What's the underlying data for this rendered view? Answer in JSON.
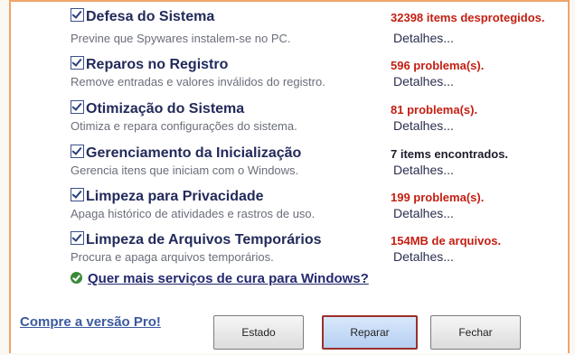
{
  "items": [
    {
      "title": "Defesa do Sistema",
      "desc": "Previne que Spywares instalem-se no PC.",
      "status": "32398 items desprotegidos.",
      "details": "Detalhes..."
    },
    {
      "title": "Reparos no Registro",
      "desc": "Remove entradas e valores inválidos do registro.",
      "status": "596 problema(s).",
      "details": "Detalhes..."
    },
    {
      "title": "Otimização do Sistema",
      "desc": "Otimiza e repara configurações do sistema.",
      "status": "81 problema(s).",
      "details": "Detalhes..."
    },
    {
      "title": "Gerenciamento da Inicialização",
      "desc": "Gerencia itens que iniciam com o Windows.",
      "status": "7 items encontrados.",
      "details": "Detalhes..."
    },
    {
      "title": "Limpeza para Privacidade",
      "desc": "Apaga histórico de atividades e rastros de uso.",
      "status": "199 problema(s).",
      "details": "Detalhes..."
    },
    {
      "title": "Limpeza de Arquivos Temporários",
      "desc": "Procura e apaga arquivos temporários.",
      "status": "154MB de arquivos.",
      "details": "Detalhes..."
    }
  ],
  "more_link": "Quer mais serviços de cura para Windows?",
  "buy_link": "Compre a versão Pro!",
  "buttons": {
    "status": "Estado",
    "repair": "Reparar",
    "close": "Fechar"
  },
  "colors": {
    "problem": "#c41e12",
    "title": "#222a5a",
    "border": "#f0a46a"
  }
}
